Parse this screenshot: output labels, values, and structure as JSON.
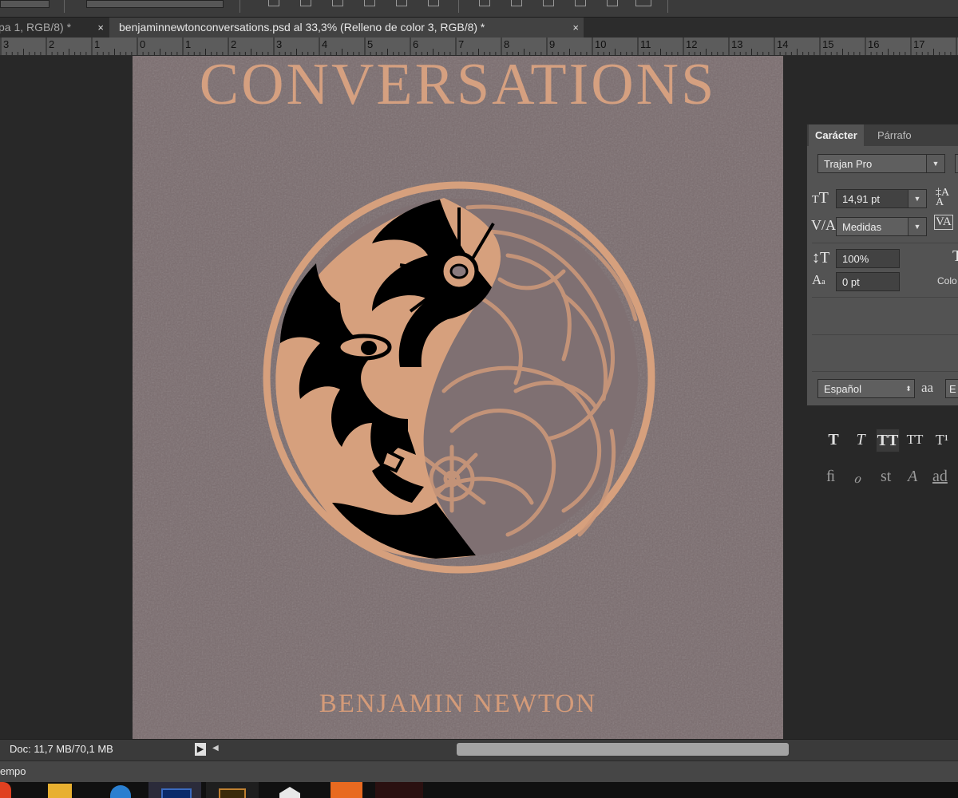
{
  "tabs": [
    {
      "label": "pa 1, RGB/8) *",
      "close": "×"
    },
    {
      "label": "benjaminnewtonconversations.psd al 33,3% (Relleno de color 3, RGB/8) *",
      "close": "×"
    }
  ],
  "ruler": {
    "marks": [
      "3",
      "2",
      "1",
      "0",
      "1",
      "2",
      "3",
      "4",
      "5",
      "6",
      "7",
      "8",
      "9",
      "10",
      "11",
      "12",
      "13",
      "14",
      "15",
      "16",
      "17"
    ]
  },
  "document": {
    "title": "CONVERSATIONS",
    "author": "BENJAMIN NEWTON",
    "colors": {
      "background": "#7a6c6e",
      "accent": "#d6a07d",
      "ink": "#000000"
    }
  },
  "panel": {
    "tabs": [
      "Carácter",
      "Párrafo"
    ],
    "font_family": "Trajan Pro",
    "font_size": "14,91 pt",
    "kerning": "Medidas",
    "vertical_scale": "100%",
    "baseline_shift": "0 pt",
    "color_label": "Colo",
    "language": "Español",
    "antialias_icon": "aa",
    "antialias_value": "E",
    "style_buttons": [
      "T",
      "T",
      "TT",
      "TT",
      "T¹"
    ],
    "opentype_buttons": [
      "ﬁ",
      "ℴ",
      "st",
      "A",
      "ad"
    ]
  },
  "status": {
    "doc_info": "Doc: 11,7 MB/70,1 MB",
    "play_icon": "▶",
    "left_arrow_icon": "◀"
  },
  "timeline": {
    "label": "empo"
  },
  "icons": {
    "font_size": "font-size-icon",
    "leading": "leading-icon",
    "kerning": "kerning-icon",
    "tracking": "tracking-icon",
    "vertical_scale": "vertical-scale-icon",
    "horizontal_scale": "horizontal-scale-icon",
    "baseline": "baseline-shift-icon"
  }
}
